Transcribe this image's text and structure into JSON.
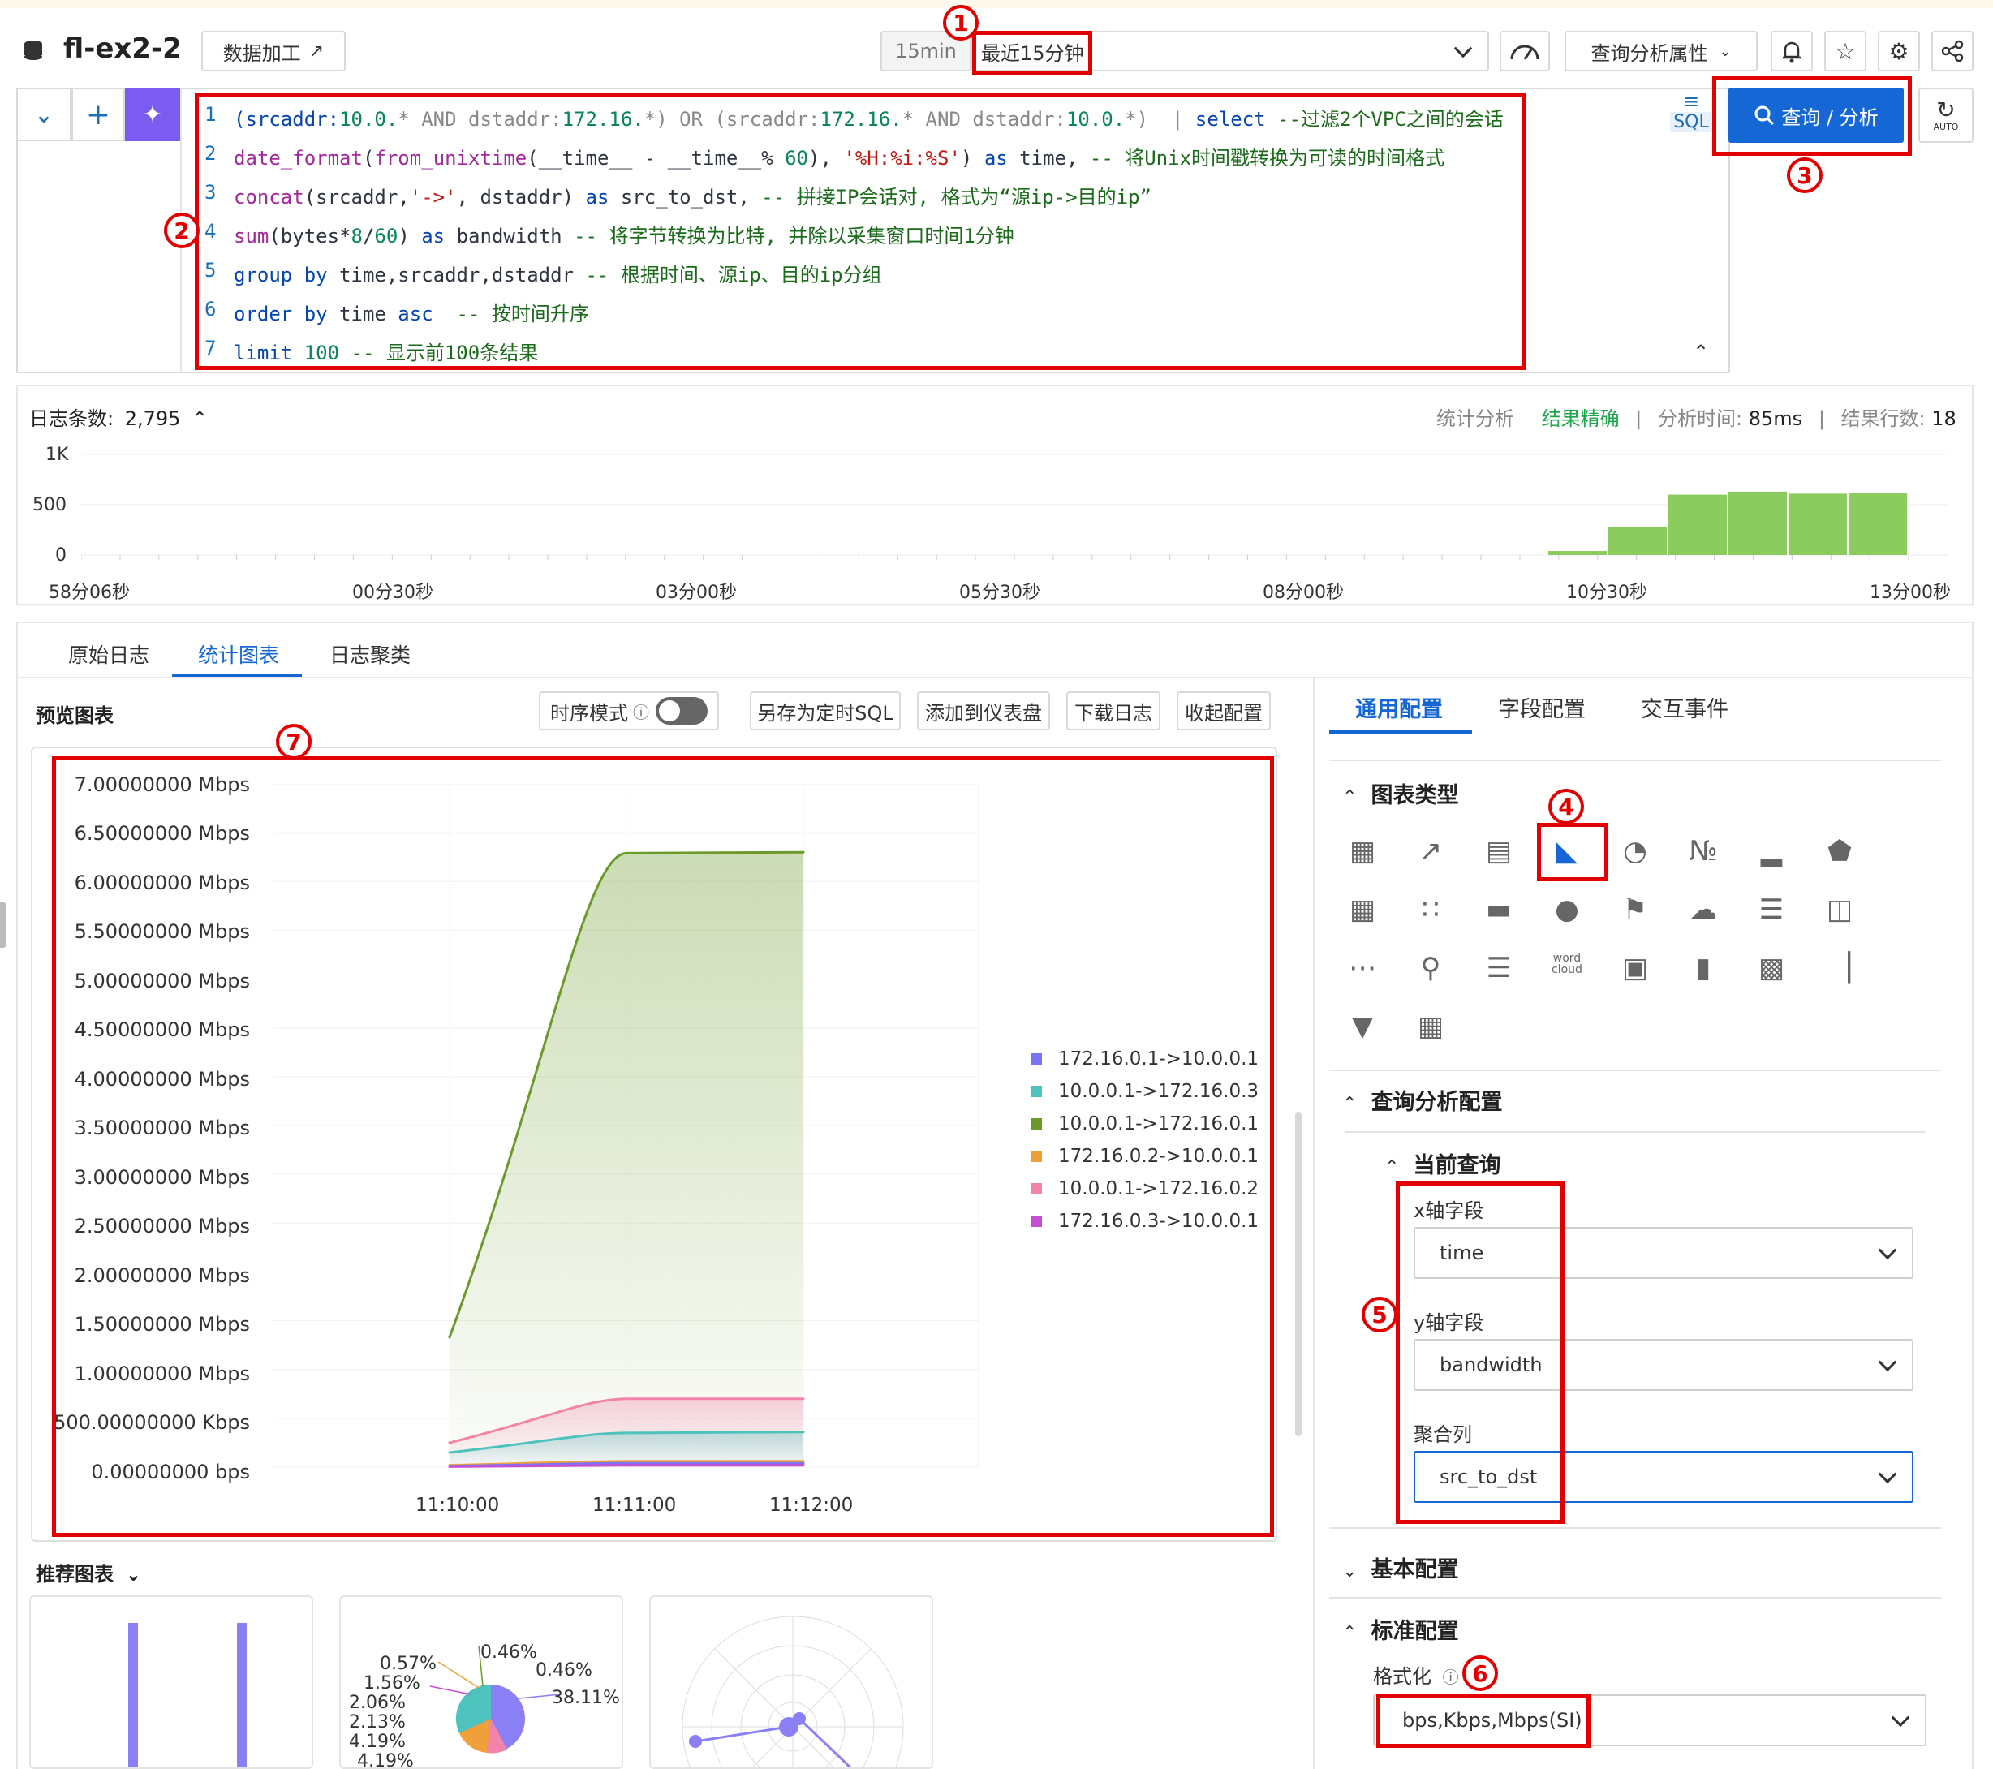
{
  "header": {
    "logstore_name": "fl-ex2-2",
    "data_processing_label": "数据加工",
    "time_quick_label": "15min",
    "time_range_label": "最近15分钟",
    "query_properties_label": "查询分析属性"
  },
  "editor": {
    "lines": [
      {
        "no": "1"
      },
      {
        "no": "2"
      },
      {
        "no": "3"
      },
      {
        "no": "4"
      },
      {
        "no": "5"
      },
      {
        "no": "6"
      },
      {
        "no": "7"
      }
    ],
    "line1": {
      "a": "(srcaddr:",
      "b": "10.0.",
      "c": "* AND dstaddr:",
      "d": "172.16.",
      "e": "*) OR (srcaddr:",
      "f": "172.16.",
      "g": "* AND dstaddr:",
      "h": "10.0.",
      "i": "*)  |",
      "j": " select",
      "k": " --过滤2个VPC之间的会话"
    },
    "line2": {
      "a": "date_format",
      "b": "(",
      "c": "from_unixtime",
      "d": "(__time__ - __time__% ",
      "e": "60",
      "f": "), ",
      "g": "'%H:%i:%S'",
      "h": ") ",
      "i": "as",
      "j": " time, ",
      "k": "-- 将Unix时间戳转换为可读的时间格式"
    },
    "line3": {
      "a": "concat",
      "b": "(srcaddr,",
      "c": "'->'",
      "d": ", dstaddr) ",
      "e": "as",
      "f": " src_to_dst, ",
      "g": "-- 拼接IP会话对, 格式为“源ip->目的ip”"
    },
    "line4": {
      "a": "sum",
      "b": "(bytes*",
      "c": "8",
      "d": "/",
      "e": "60",
      "f": ") ",
      "g": "as",
      "h": " bandwidth ",
      "i": "-- 将字节转换为比特, 并除以采集窗口时间1分钟"
    },
    "line5": {
      "a": "group by",
      "b": " time,srcaddr,dstaddr ",
      "c": "-- 根据时间、源ip、目的ip分组"
    },
    "line6": {
      "a": "order by",
      "b": " time ",
      "c": "asc",
      "d": "  -- 按时间升序"
    },
    "line7": {
      "a": "limit",
      "b": " ",
      "c": "100",
      "d": " -- 显示前100条结果"
    },
    "sql_label": "SQL",
    "query_button_label": "查询 / 分析",
    "auto_label": "AUTO"
  },
  "histogram": {
    "log_count_label": "日志条数:",
    "log_count_value": "2,795",
    "stats_label": "统计分析",
    "accuracy_label": "结果精确",
    "analysis_time_label": "分析时间:",
    "analysis_time_value": "85ms",
    "result_rows_label": "结果行数:",
    "result_rows_value": "18",
    "yticks": [
      "1K",
      "500",
      "0"
    ],
    "xticks": [
      "58分06秒",
      "00分30秒",
      "03分00秒",
      "05分30秒",
      "08分00秒",
      "10分30秒",
      "13分00秒"
    ],
    "bars": [
      {
        "value": 40
      },
      {
        "value": 280
      },
      {
        "value": 600
      },
      {
        "value": 630
      },
      {
        "value": 610
      },
      {
        "value": 620
      }
    ]
  },
  "result_tabs": [
    "原始日志",
    "统计图表",
    "日志聚类"
  ],
  "preview": {
    "title": "预览图表",
    "timeseries_mode_label": "时序模式",
    "save_sql_label": "另存为定时SQL",
    "add_dashboard_label": "添加到仪表盘",
    "download_label": "下载日志",
    "collapse_label": "收起配置"
  },
  "chart_data": {
    "type": "area",
    "x": [
      "11:10:00",
      "11:11:00",
      "11:12:00"
    ],
    "yticks": [
      "7.00000000 Mbps",
      "6.50000000 Mbps",
      "6.00000000 Mbps",
      "5.50000000 Mbps",
      "5.00000000 Mbps",
      "4.50000000 Mbps",
      "4.00000000 Mbps",
      "3.50000000 Mbps",
      "3.00000000 Mbps",
      "2.50000000 Mbps",
      "2.00000000 Mbps",
      "1.50000000 Mbps",
      "1.00000000 Mbps",
      "500.00000000 Kbps",
      "0.00000000 bps"
    ],
    "ylim": [
      0,
      7000000
    ],
    "series": [
      {
        "name": "172.16.0.1->10.0.0.1",
        "color": "#7b74f2",
        "values": [
          10000,
          40000,
          40000
        ]
      },
      {
        "name": "10.0.0.1->172.16.0.3",
        "color": "#4ec2bd",
        "values": [
          150000,
          350000,
          360000
        ]
      },
      {
        "name": "10.0.0.1->172.16.0.1",
        "color": "#6c9a2a",
        "values": [
          1330000,
          6290000,
          6300000
        ]
      },
      {
        "name": "172.16.0.2->10.0.0.1",
        "color": "#f0a03a",
        "values": [
          20000,
          60000,
          60000
        ]
      },
      {
        "name": "10.0.0.1->172.16.0.2",
        "color": "#f184a8",
        "values": [
          250000,
          700000,
          700000
        ]
      },
      {
        "name": "172.16.0.3->10.0.0.1",
        "color": "#c64dd4",
        "values": [
          5000,
          20000,
          20000
        ]
      }
    ]
  },
  "recommend": {
    "title": "推荐图表",
    "pie_labels": [
      "0.46%",
      "0.57%",
      "0.46%",
      "1.56%",
      "38.11%",
      "2.06%",
      "2.13%",
      "4.19%",
      "4.19%"
    ]
  },
  "config": {
    "tabs": [
      "通用配置",
      "字段配置",
      "交互事件"
    ],
    "chart_type_title": "图表类型",
    "query_config_title": "查询分析配置",
    "current_query_title": "当前查询",
    "x_field_label": "x轴字段",
    "x_field_value": "time",
    "y_field_label": "y轴字段",
    "y_field_value": "bandwidth",
    "agg_label": "聚合列",
    "agg_value": "src_to_dst",
    "basic_config_title": "基本配置",
    "standard_config_title": "标准配置",
    "format_label": "格式化",
    "format_value": "bps,Kbps,Mbps(SI)",
    "wordcloud_label": "word cloud"
  },
  "annotations": [
    "1",
    "2",
    "3",
    "4",
    "5",
    "6",
    "7"
  ]
}
